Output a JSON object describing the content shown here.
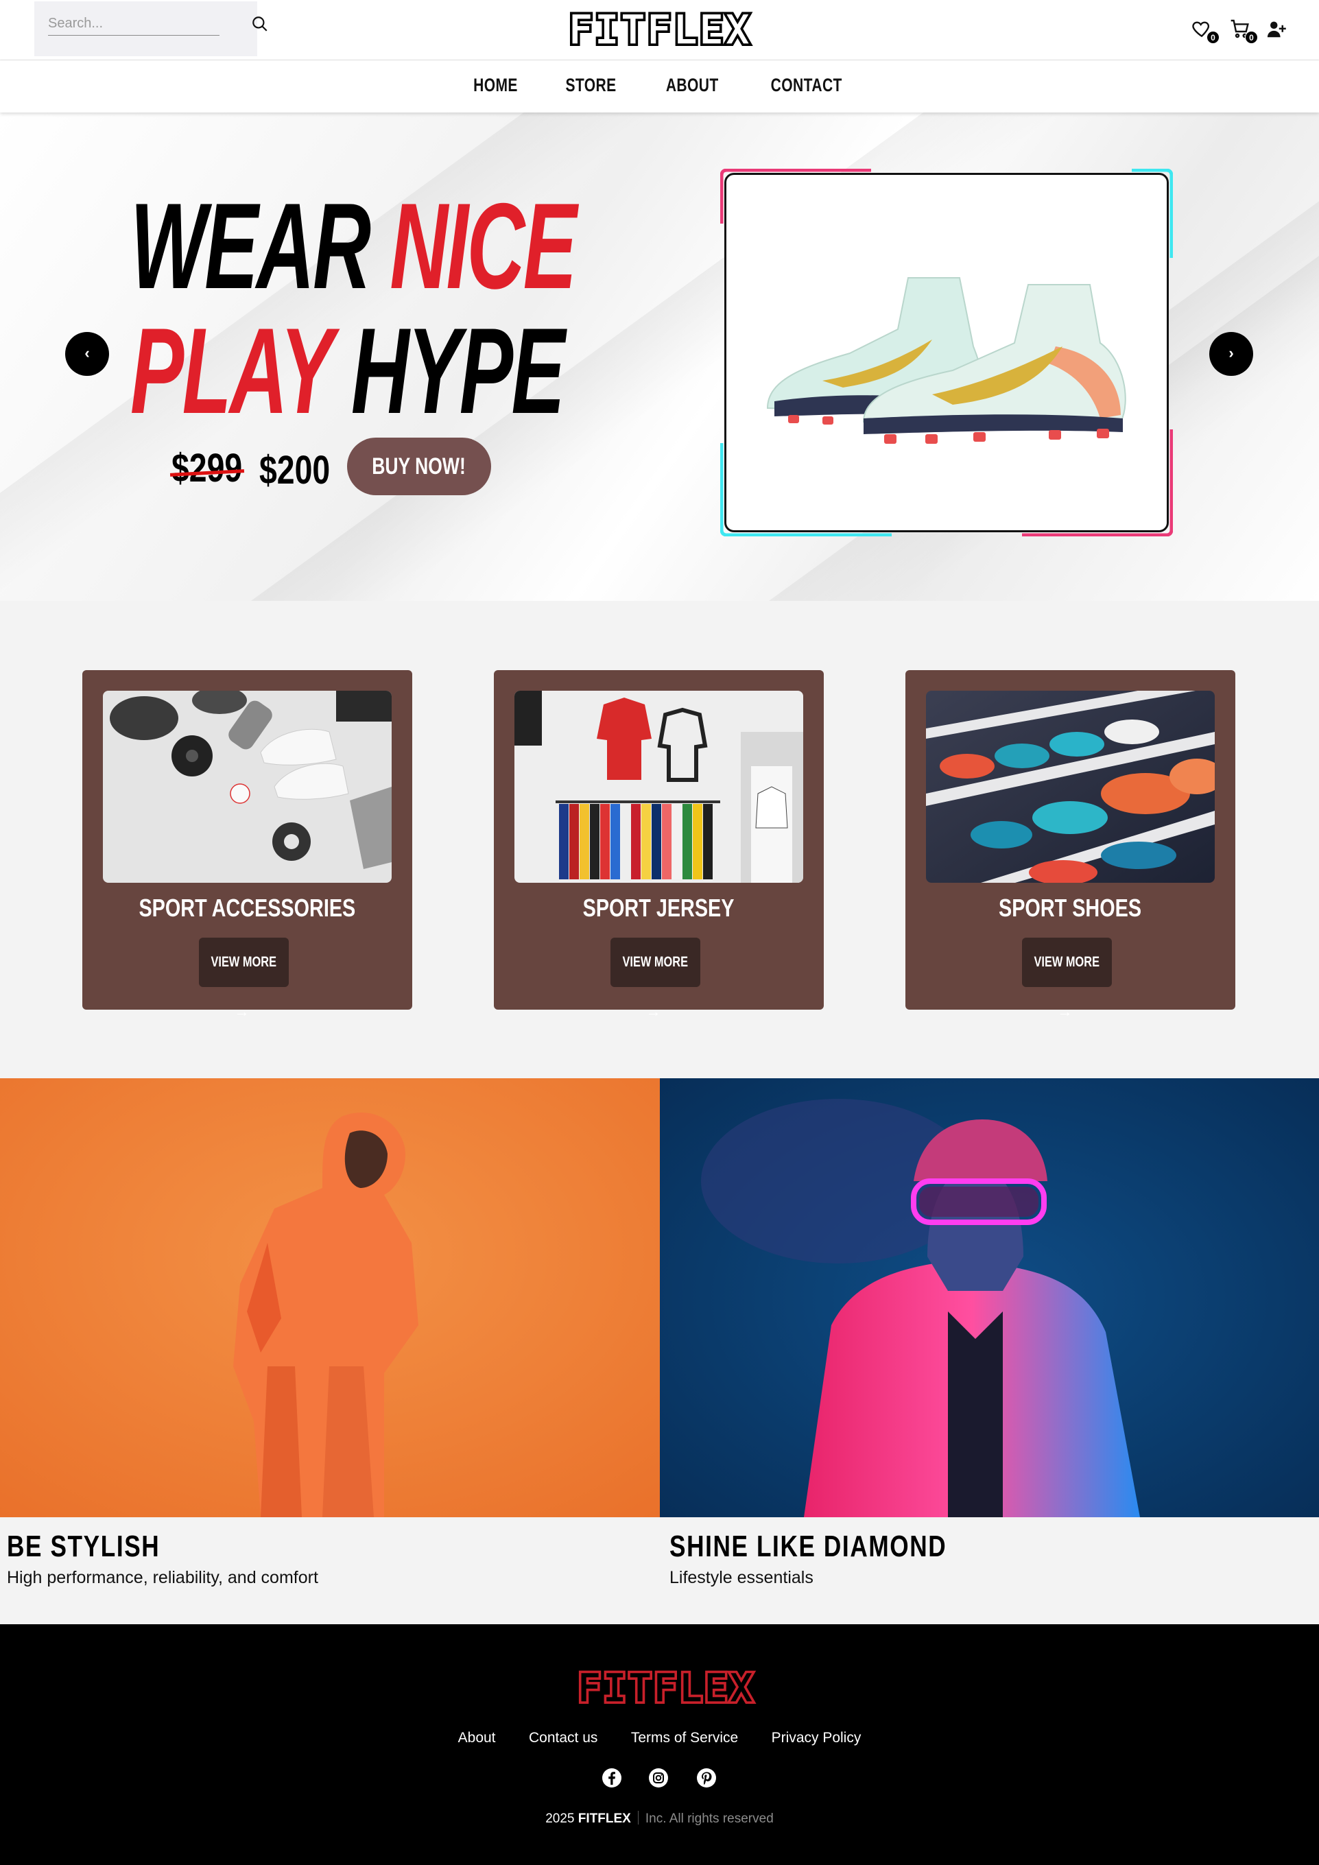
{
  "header": {
    "search_placeholder": "Search...",
    "brand": "FITFLEX",
    "wishlist_count": "0",
    "cart_count": "0"
  },
  "nav": [
    "HOME",
    "STORE",
    "ABOUT",
    "CONTACT"
  ],
  "hero": {
    "line1_a": "WEAR",
    "line1_b": "NICE",
    "line2_a": "PLAY",
    "line2_b": "HYPE",
    "old_price": "$299",
    "new_price": "$200",
    "cta": "BUY NOW!",
    "prev": "‹",
    "next": "›"
  },
  "categories": [
    {
      "title": "SPORT ACCESSORIES",
      "button": "VIEW MORE"
    },
    {
      "title": "SPORT JERSEY",
      "button": "VIEW MORE"
    },
    {
      "title": "SPORT SHOES",
      "button": "VIEW MORE"
    }
  ],
  "promos": [
    {
      "title": "BE STYLISH",
      "subtitle": "High performance, reliability, and comfort"
    },
    {
      "title": "SHINE LIKE DIAMOND",
      "subtitle": "Lifestyle essentials"
    }
  ],
  "footer": {
    "brand": "FITFLEX",
    "links": [
      "About",
      "Contact us",
      "Terms of Service",
      "Privacy Policy"
    ],
    "copyright_year": "2025",
    "copyright_brand": "FITFLEX",
    "copyright_rest": "Inc. All rights reserved"
  },
  "colors": {
    "accent_red": "#e0202a",
    "card_brown": "#67453f",
    "button_dark": "#3a2825",
    "buy_button": "#75504f"
  }
}
